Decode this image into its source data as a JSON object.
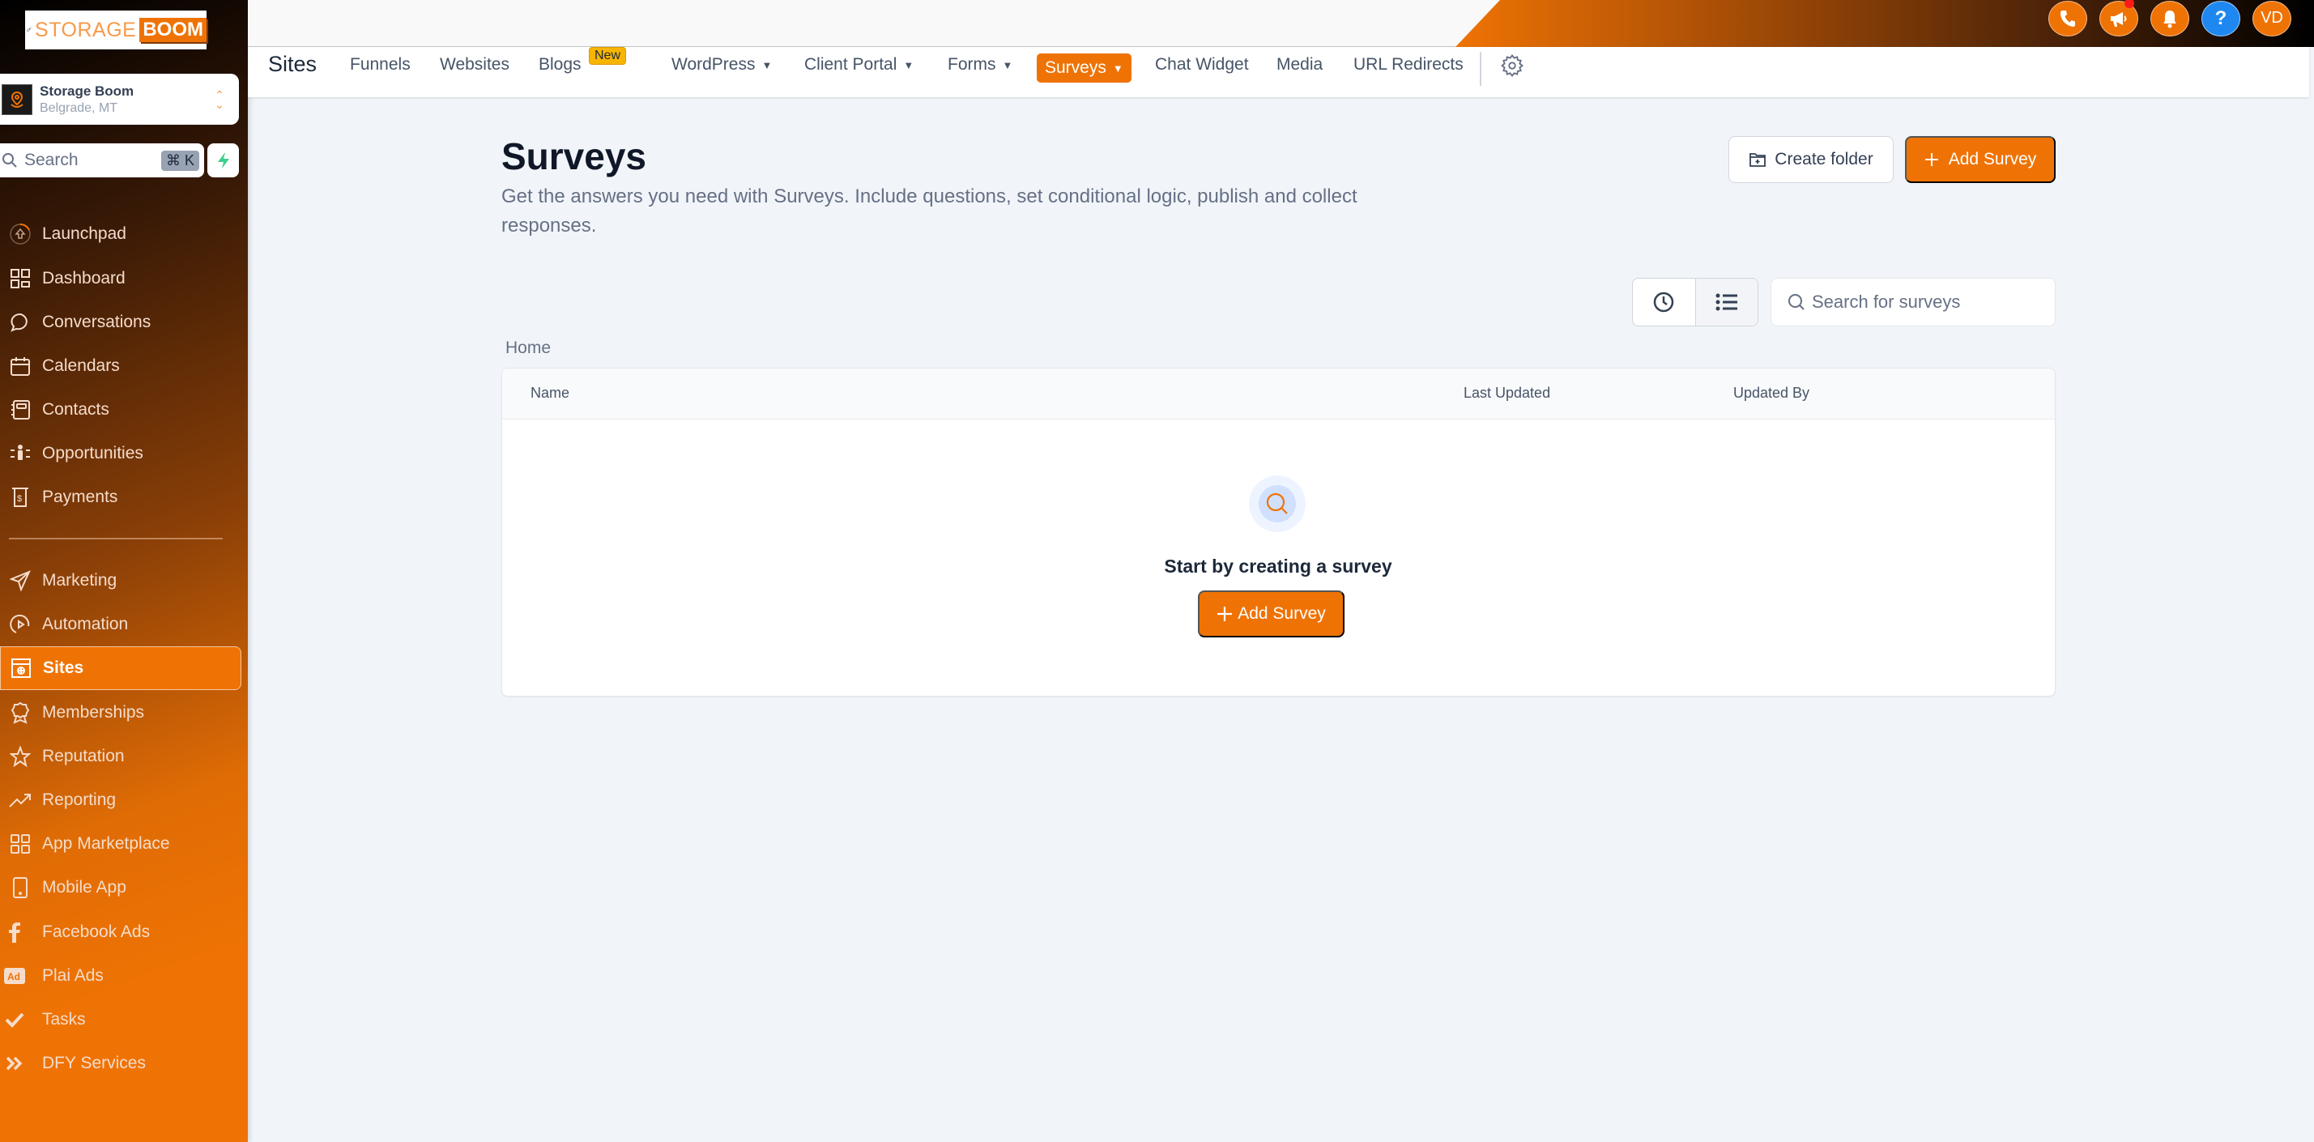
{
  "brand": {
    "logo_text_light": "STORAGE",
    "logo_text_bold": "BOOM"
  },
  "account": {
    "name": "Storage Boom",
    "location": "Belgrade, MT",
    "icon": "map-pin-icon"
  },
  "sidebar_search": {
    "placeholder": "Search",
    "shortcut": "⌘ K",
    "quick_action_icon": "bolt-icon"
  },
  "sidebar": {
    "items": [
      {
        "label": "Launchpad",
        "icon": "launchpad-icon",
        "active": false
      },
      {
        "label": "Dashboard",
        "icon": "dashboard-grid-icon",
        "active": false
      },
      {
        "label": "Conversations",
        "icon": "chat-bubble-icon",
        "active": false
      },
      {
        "label": "Calendars",
        "icon": "calendar-icon",
        "active": false
      },
      {
        "label": "Contacts",
        "icon": "contacts-book-icon",
        "active": false
      },
      {
        "label": "Opportunities",
        "icon": "opportunities-icon",
        "active": false
      },
      {
        "label": "Payments",
        "icon": "payments-icon",
        "active": false
      },
      {
        "label": "Marketing",
        "icon": "send-icon",
        "active": false
      },
      {
        "label": "Automation",
        "icon": "automation-icon",
        "active": false
      },
      {
        "label": "Sites",
        "icon": "sites-globe-icon",
        "active": true
      },
      {
        "label": "Memberships",
        "icon": "award-icon",
        "active": false
      },
      {
        "label": "Reputation",
        "icon": "star-icon",
        "active": false
      },
      {
        "label": "Reporting",
        "icon": "trending-up-icon",
        "active": false
      },
      {
        "label": "App Marketplace",
        "icon": "apps-grid-icon",
        "active": false
      },
      {
        "label": "Mobile App",
        "icon": "mobile-icon",
        "active": false
      },
      {
        "label": "Facebook Ads",
        "icon": "facebook-icon",
        "active": false
      },
      {
        "label": "Plai Ads",
        "icon": "ad-icon",
        "active": false
      },
      {
        "label": "Tasks",
        "icon": "check-icon",
        "active": false
      },
      {
        "label": "DFY Services",
        "icon": "double-chevron-icon",
        "active": false
      }
    ]
  },
  "header": {
    "icons": [
      "phone-icon",
      "megaphone-icon",
      "bell-icon",
      "help-icon"
    ],
    "avatar_initials": "VD",
    "help_label": "?",
    "colors": {
      "accent": "#ef7304",
      "help": "#1e88f0",
      "notification_dot": "#ff1a1a"
    }
  },
  "subnav": {
    "title": "Sites",
    "tabs": [
      {
        "label": "Funnels",
        "dropdown": false
      },
      {
        "label": "Websites",
        "dropdown": false
      },
      {
        "label": "Blogs",
        "dropdown": false,
        "badge": "New"
      },
      {
        "label": "WordPress",
        "dropdown": true
      },
      {
        "label": "Client Portal",
        "dropdown": true
      },
      {
        "label": "Forms",
        "dropdown": true
      },
      {
        "label": "Surveys",
        "dropdown": true,
        "active": true
      },
      {
        "label": "Chat Widget",
        "dropdown": false
      },
      {
        "label": "Media",
        "dropdown": false
      },
      {
        "label": "URL Redirects",
        "dropdown": false
      }
    ],
    "settings_icon": "gear-icon"
  },
  "main": {
    "title": "Surveys",
    "description": "Get the answers you need with Surveys. Include questions, set conditional logic, publish and collect responses.",
    "create_folder_label": "Create folder",
    "add_survey_label": "Add Survey",
    "search_placeholder": "Search for surveys",
    "search_value": "",
    "breadcrumb": "Home",
    "table": {
      "columns": [
        "Name",
        "Last Updated",
        "Updated By"
      ],
      "rows": []
    },
    "empty_state": {
      "title": "Start by creating a survey",
      "button_label": "Add Survey"
    }
  }
}
